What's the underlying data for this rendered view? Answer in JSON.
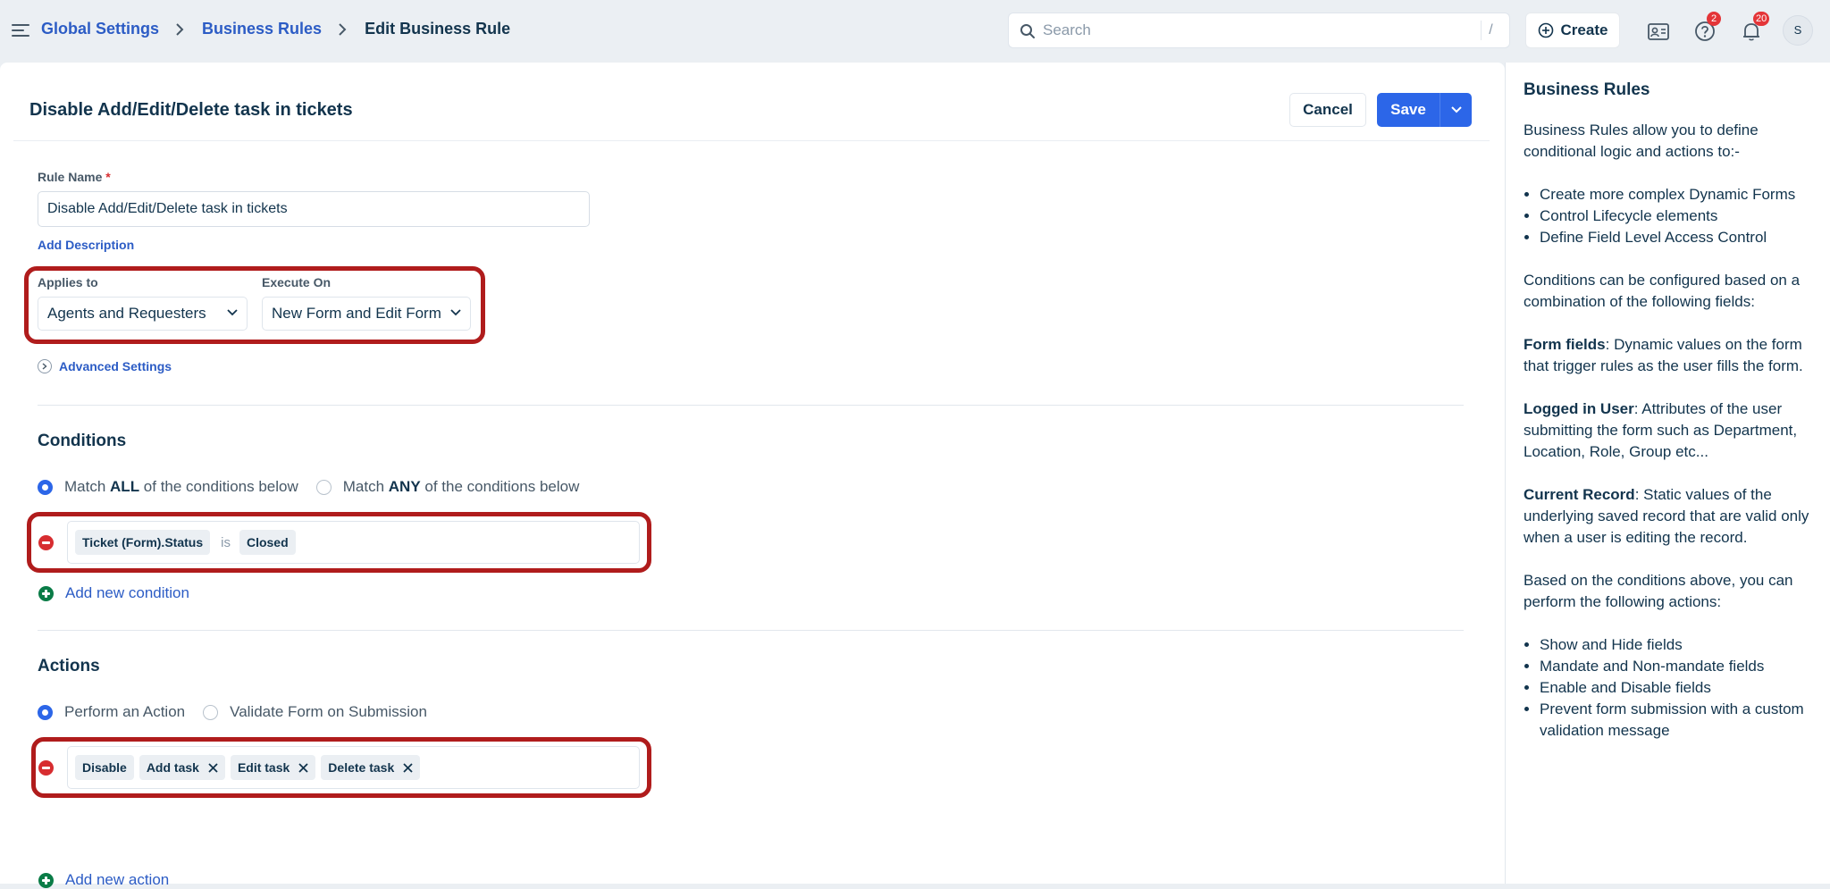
{
  "breadcrumb": {
    "items": [
      "Global Settings",
      "Business Rules"
    ],
    "current": "Edit Business Rule"
  },
  "search": {
    "placeholder": "Search",
    "shortcut": "/"
  },
  "topbar": {
    "create_label": "Create",
    "help_badge": "2",
    "notifications_badge": "20",
    "avatar_initial": "S"
  },
  "header": {
    "title": "Disable Add/Edit/Delete task in tickets",
    "cancel_label": "Cancel",
    "save_label": "Save"
  },
  "form": {
    "rule_name_label": "Rule Name",
    "rule_name_required": "*",
    "rule_name_value": "Disable Add/Edit/Delete task in tickets",
    "add_description": "Add Description",
    "applies_to_label": "Applies to",
    "applies_to_value": "Agents and Requesters",
    "execute_on_label": "Execute On",
    "execute_on_value": "New Form and Edit Form",
    "advanced_settings": "Advanced Settings"
  },
  "conditions": {
    "title": "Conditions",
    "match_all_prefix": "Match ",
    "match_all_bold": "ALL",
    "match_all_suffix": " of the conditions below",
    "match_any_prefix": "Match ",
    "match_any_bold": "ANY",
    "match_any_suffix": " of the conditions below",
    "selected": "all",
    "field": "Ticket (Form).Status",
    "operator": "is",
    "value": "Closed",
    "add_label": "Add new condition"
  },
  "actions": {
    "title": "Actions",
    "perform_label": "Perform an Action",
    "validate_label": "Validate Form on Submission",
    "selected": "perform",
    "action": "Disable",
    "targets": [
      "Add task",
      "Edit task",
      "Delete task"
    ],
    "add_label": "Add new action"
  },
  "side_panel": {
    "title": "Business Rules",
    "intro": "Business Rules allow you to define conditional logic and actions to:-",
    "intro_list": [
      "Create more complex Dynamic Forms",
      "Control Lifecycle elements",
      "Define Field Level Access Control"
    ],
    "conditions_text": "Conditions can be configured based on a combination of the following fields:",
    "form_fields_bold": "Form fields",
    "form_fields_text": ": Dynamic values on the form that trigger rules as the user fills the form.",
    "logged_user_bold": "Logged in User",
    "logged_user_text": ": Attributes of the user submitting the form such as Department, Location, Role, Group etc...",
    "current_record_bold": "Current Record",
    "current_record_text": ": Static values of the underlying saved record that are valid only when a user is editing the record.",
    "actions_text": "Based on the conditions above, you can perform the following actions:",
    "actions_list": [
      "Show and Hide fields",
      "Mandate and Non-mandate fields",
      "Enable and Disable fields",
      "Prevent form submission with a custom validation message"
    ]
  },
  "colors": {
    "primary": "#2c66e8",
    "link": "#2c5cc5",
    "highlight": "#b01c1c",
    "danger": "#d72d30",
    "success": "#0a7c47"
  }
}
